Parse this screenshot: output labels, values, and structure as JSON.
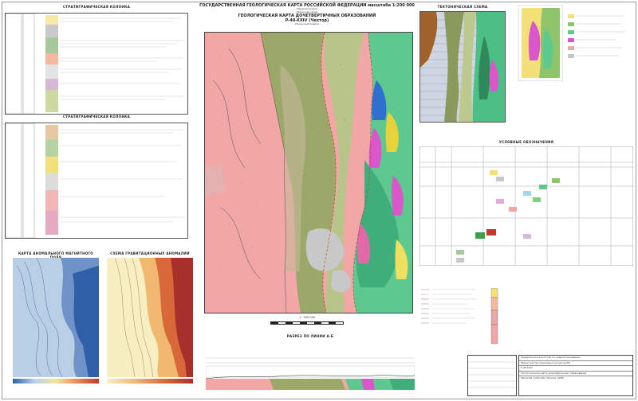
{
  "sheet": {
    "title_main": "ГОСУДАРСТВЕННАЯ ГЕОЛОГИЧЕСКАЯ КАРТА РОССИЙСКОЙ ФЕДЕРАЦИИ масштаба 1:200 000",
    "series": "Издание второе",
    "subseries": "Уральская серия",
    "map_type": "ГЕОЛОГИЧЕСКАЯ КАРТА ДОЧЕТВЕРТИЧНЫХ ОБРАЗОВАНИЙ",
    "sheet_no": "P-40-XXIV (Чехтор)",
    "sheet_note": "(Уральский район)"
  },
  "panels": {
    "strat_col_1": "СТРАТИГРАФИЧЕСКАЯ КОЛОНКА",
    "strat_col_2": "СТРАТИГРАФИЧЕСКАЯ КОЛОНКА",
    "tectonic": "ТЕКТОНИЧЕСКАЯ СХЕМА",
    "legend": "УСЛОВНЫЕ ОБОЗНАЧЕНИЯ",
    "magnetic": "КАРТА АНОМАЛЬНОГО МАГНИТНОГО ПОЛЯ",
    "gravity": "СХЕМА ГРАВИТАЦИОННЫХ АНОМАЛИЙ",
    "section": "РАЗРЕЗ ПО ЛИНИИ",
    "section_ab": "А-Б",
    "scale": "1 : 200 000"
  },
  "colors": {
    "pink": "#f2a7a7",
    "olive": "#9aa86a",
    "green": "#5ec98e",
    "magenta": "#d957c8",
    "grey": "#c8c8c8",
    "yellow": "#f4e07a",
    "blue": "#4a7fbf",
    "red": "#c8503a"
  },
  "stamp": {
    "rows": [
      "Федеральное агентство по недропользованию",
      "Министерство природных ресурсов РФ",
      "P-40-XXIV",
      "Геологическая карта дочетвертичных образований",
      "Масштаб 1:200 000, Москва, 2006"
    ]
  }
}
